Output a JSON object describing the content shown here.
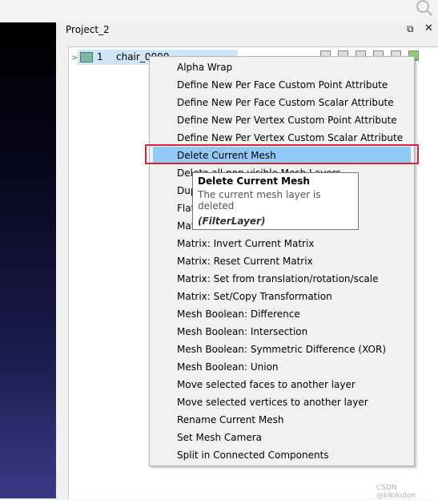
{
  "panel": {
    "title": "Project_2",
    "float_icon": "⧉",
    "close_icon": "✕"
  },
  "layer": {
    "index": "1",
    "name": "chair_0000"
  },
  "menu": {
    "items": [
      "Alpha Wrap",
      "Define New Per Face Custom Point Attribute",
      "Define New Per Face Custom Scalar Attribute",
      "Define New Per Vertex Custom Point Attribute",
      "Define New Per Vertex Custom Scalar Attribute",
      "Delete Current Mesh",
      "Delete all non visible Mesh Layers",
      "Duplicate Current Mesh",
      "Flatten Visible Layers",
      "Matrix: Freeze Current Matrix",
      "Matrix: Invert Current Matrix",
      "Matrix: Reset Current Matrix",
      "Matrix: Set from translation/rotation/scale",
      "Matrix: Set/Copy Transformation",
      "Mesh Boolean: Difference",
      "Mesh Boolean: Intersection",
      "Mesh Boolean: Symmetric Difference (XOR)",
      "Mesh Boolean: Union",
      "Move selected faces to another layer",
      "Move selected vertices to another layer",
      "Rename Current Mesh",
      "Set Mesh Camera",
      "Split in Connected Components"
    ],
    "active_index": 5
  },
  "tooltip": {
    "title": "Delete Current Mesh",
    "description": "The current mesh layer is deleted",
    "filter_class": "(FilterLayer)"
  },
  "watermark": "CSDN @kikikidoit",
  "colors": {
    "highlight": "#91c9f7",
    "annotation_box": "#d9262a"
  }
}
